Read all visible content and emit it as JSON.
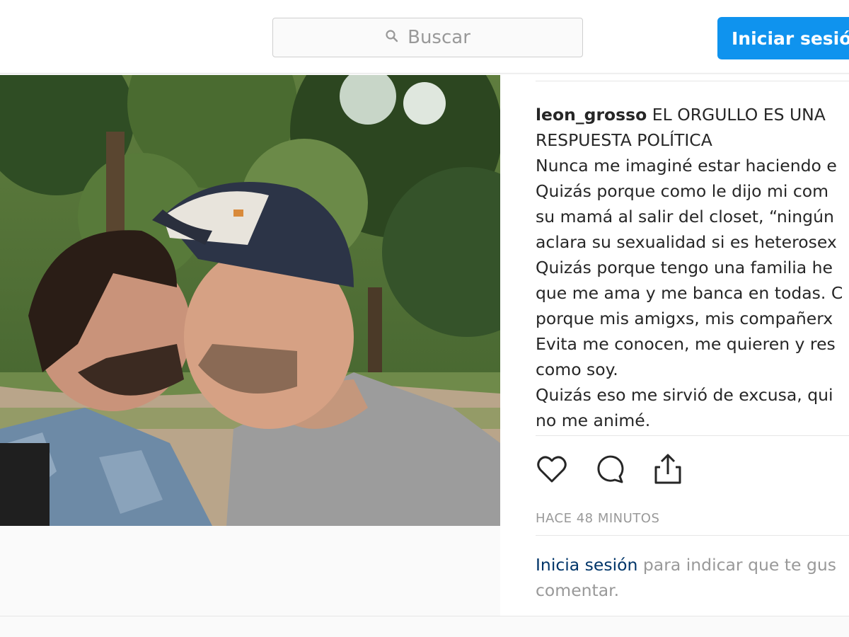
{
  "header": {
    "search_placeholder": "Buscar",
    "login_button": "Iniciar sesión"
  },
  "post": {
    "photo_icon": "photo-two-men-kissing-in-park",
    "username": "leon_grosso",
    "caption_lines": [
      "EL ORGULLO ES UNA",
      "RESPUESTA POLÍTICA",
      "Nunca me imaginé estar haciendo e",
      "Quizás porque como le dijo mi com",
      "su mamá al salir del closet, “ningún",
      "aclara su sexualidad si es heterosex",
      "Quizás porque tengo una familia he",
      "que me ama y me banca en todas. C",
      "porque mis amigxs, mis compañerx",
      "Evita me conocen, me quieren y res",
      "como soy.",
      "Quizás eso me sirvió de excusa, qui",
      "no me animé."
    ],
    "actions": [
      "heart-icon",
      "comment-icon",
      "share-icon"
    ],
    "timestamp": "HACE 48 MINUTOS",
    "login_prompt": {
      "link": "Inicia sesión",
      "text_1": " para indicar que te gus",
      "text_2": "comentar."
    }
  },
  "colors": {
    "accent": "#0f93ee",
    "link": "#003569",
    "muted": "#999999"
  }
}
